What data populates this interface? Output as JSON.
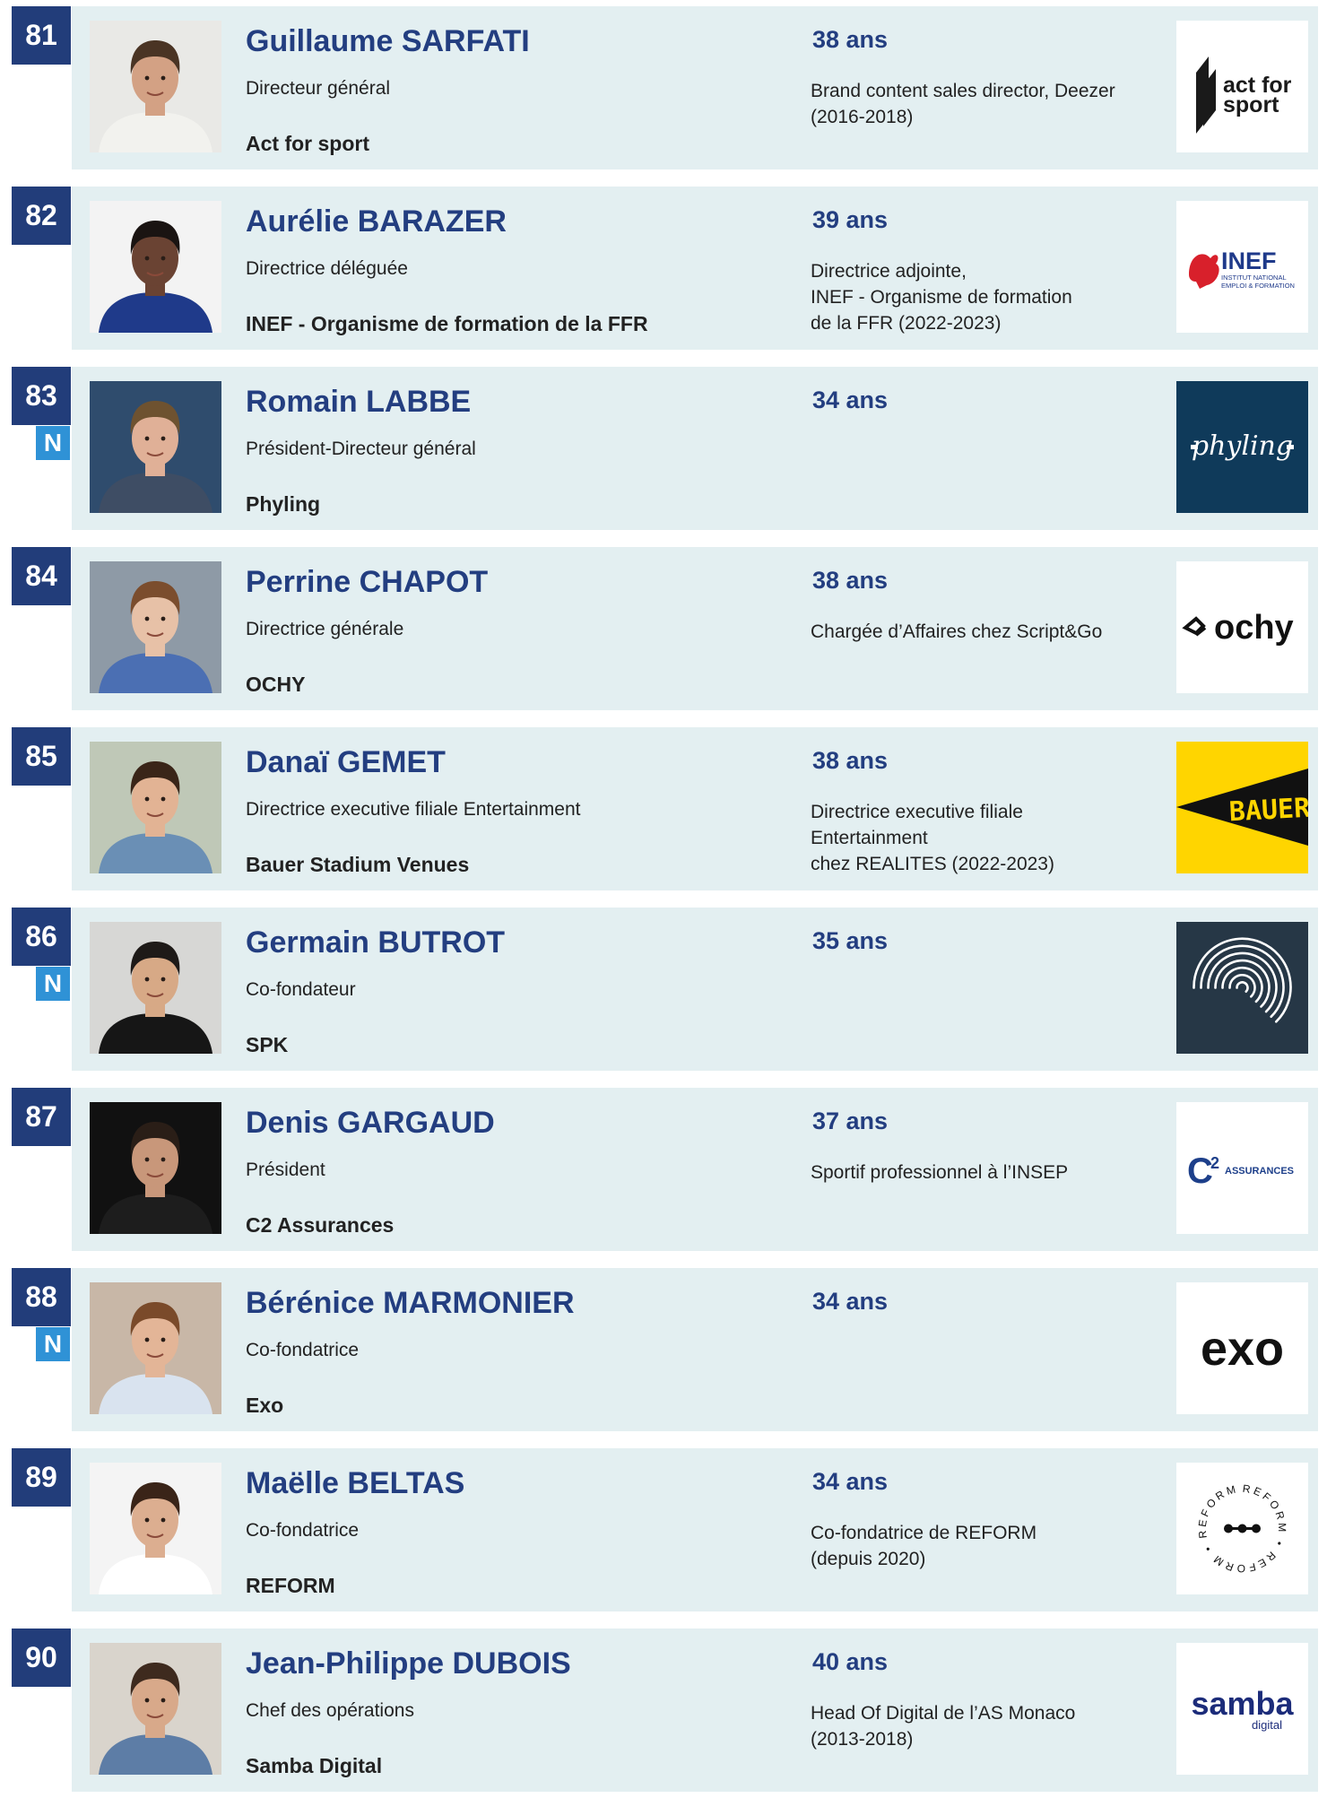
{
  "entries": [
    {
      "rank": "81",
      "new_badge": "",
      "name": "Guillaume SARFATI",
      "role": "Directeur général",
      "company": "Act for sport",
      "age": "38 ans",
      "previous": "Brand content sales director, Deezer\n(2016-2018)",
      "photo": {
        "bg": "#e9e9e6",
        "skin": "#d3a184",
        "hair": "#4a3424",
        "shirt": "#f2f2ee"
      },
      "logo": {
        "kind": "actforsport",
        "bg": "#ffffff",
        "fg": "#1a1a1a",
        "text1": "act for",
        "text2": "sport"
      }
    },
    {
      "rank": "82",
      "new_badge": "",
      "name": "Aurélie BARAZER",
      "role": "Directrice déléguée",
      "company": "INEF - Organisme de formation de la FFR",
      "age": "39 ans",
      "previous": "Directrice adjointe,\nINEF - Organisme de formation\nde la FFR (2022-2023)",
      "photo": {
        "bg": "#f3f3f3",
        "skin": "#6a4333",
        "hair": "#1a1412",
        "shirt": "#1f3a8a"
      },
      "logo": {
        "kind": "inef",
        "bg": "#ffffff",
        "fg": "#1f3a8a",
        "accent": "#d8202b",
        "text1": "INEF",
        "text2": "INSTITUT NATIONAL",
        "text3": "EMPLOI & FORMATION"
      }
    },
    {
      "rank": "83",
      "new_badge": "N",
      "name": "Romain LABBE",
      "role": "Président-Directeur général",
      "company": "Phyling",
      "age": "34 ans",
      "previous": "",
      "photo": {
        "bg": "#2f4c6d",
        "skin": "#e0b097",
        "hair": "#6e5230",
        "shirt": "#3e4d64"
      },
      "logo": {
        "kind": "phyling",
        "bg": "#0f3a5a",
        "fg": "#ffffff",
        "text1": "phyling"
      }
    },
    {
      "rank": "84",
      "new_badge": "",
      "name": "Perrine CHAPOT",
      "role": "Directrice générale",
      "company": "OCHY",
      "age": "38 ans",
      "previous": "Chargée d’Affaires chez Script&Go",
      "photo": {
        "bg": "#8e9aa6",
        "skin": "#e7c1a7",
        "hair": "#7b4d2d",
        "shirt": "#4b6fb3"
      },
      "logo": {
        "kind": "ochy",
        "bg": "#ffffff",
        "fg": "#111111",
        "text1": "ochy"
      }
    },
    {
      "rank": "85",
      "new_badge": "",
      "name": "Danaï GEMET",
      "role": "Directrice executive filiale Entertainment",
      "company": "Bauer Stadium Venues",
      "age": "38 ans",
      "previous": "Directrice executive filiale\nEntertainment\nchez REALITES (2022-2023)",
      "photo": {
        "bg": "#bfc8b7",
        "skin": "#e2b394",
        "hair": "#3a2518",
        "shirt": "#6a8fb5"
      },
      "logo": {
        "kind": "bauer",
        "bg": "#ffd500",
        "fg": "#111111",
        "text1": "BAUER"
      }
    },
    {
      "rank": "86",
      "new_badge": "N",
      "name": "Germain BUTROT",
      "role": "Co-fondateur",
      "company": "SPK",
      "age": "35 ans",
      "previous": "",
      "photo": {
        "bg": "#d7d7d5",
        "skin": "#d7a986",
        "hair": "#1e1a18",
        "shirt": "#161616"
      },
      "logo": {
        "kind": "spk",
        "bg": "#263746",
        "fg": "#ffffff"
      }
    },
    {
      "rank": "87",
      "new_badge": "",
      "name": "Denis GARGAUD",
      "role": "Président",
      "company": "C2 Assurances",
      "age": "37 ans",
      "previous": "Sportif professionnel à l’INSEP",
      "photo": {
        "bg": "#111111",
        "skin": "#c8977a",
        "hair": "#2a1e17",
        "shirt": "#1d1d1d"
      },
      "logo": {
        "kind": "c2",
        "bg": "#ffffff",
        "fg": "#1d3f8a",
        "text1": "C",
        "text2": "2",
        "text3": "ASSURANCES"
      }
    },
    {
      "rank": "88",
      "new_badge": "N",
      "name": "Bérénice MARMONIER",
      "role": "Co-fondatrice",
      "company": "Exo",
      "age": "34 ans",
      "previous": "",
      "photo": {
        "bg": "#c8b7a7",
        "skin": "#e3b597",
        "hair": "#7a4a2a",
        "shirt": "#d9e3ef"
      },
      "logo": {
        "kind": "exo",
        "bg": "#ffffff",
        "fg": "#111111",
        "text1": "exo"
      }
    },
    {
      "rank": "89",
      "new_badge": "",
      "name": "Maëlle BELTAS",
      "role": "Co-fondatrice",
      "company": "REFORM",
      "age": "34 ans",
      "previous": "Co-fondatrice de REFORM\n(depuis 2020)",
      "photo": {
        "bg": "#f4f4f4",
        "skin": "#dcae90",
        "hair": "#3a2418",
        "shirt": "#ffffff"
      },
      "logo": {
        "kind": "reform",
        "bg": "#ffffff",
        "fg": "#111111",
        "text1": "REFORM"
      }
    },
    {
      "rank": "90",
      "new_badge": "",
      "name": "Jean-Philippe DUBOIS",
      "role": "Chef des opérations",
      "company": "Samba Digital",
      "age": "40 ans",
      "previous": "Head Of Digital de l’AS Monaco\n(2013-2018)",
      "photo": {
        "bg": "#d9d4cc",
        "skin": "#d8a98a",
        "hair": "#3e2a1e",
        "shirt": "#5d7da6"
      },
      "logo": {
        "kind": "samba",
        "bg": "#ffffff",
        "fg": "#1c2c7a",
        "text1": "samba",
        "text2": "digital"
      }
    }
  ]
}
